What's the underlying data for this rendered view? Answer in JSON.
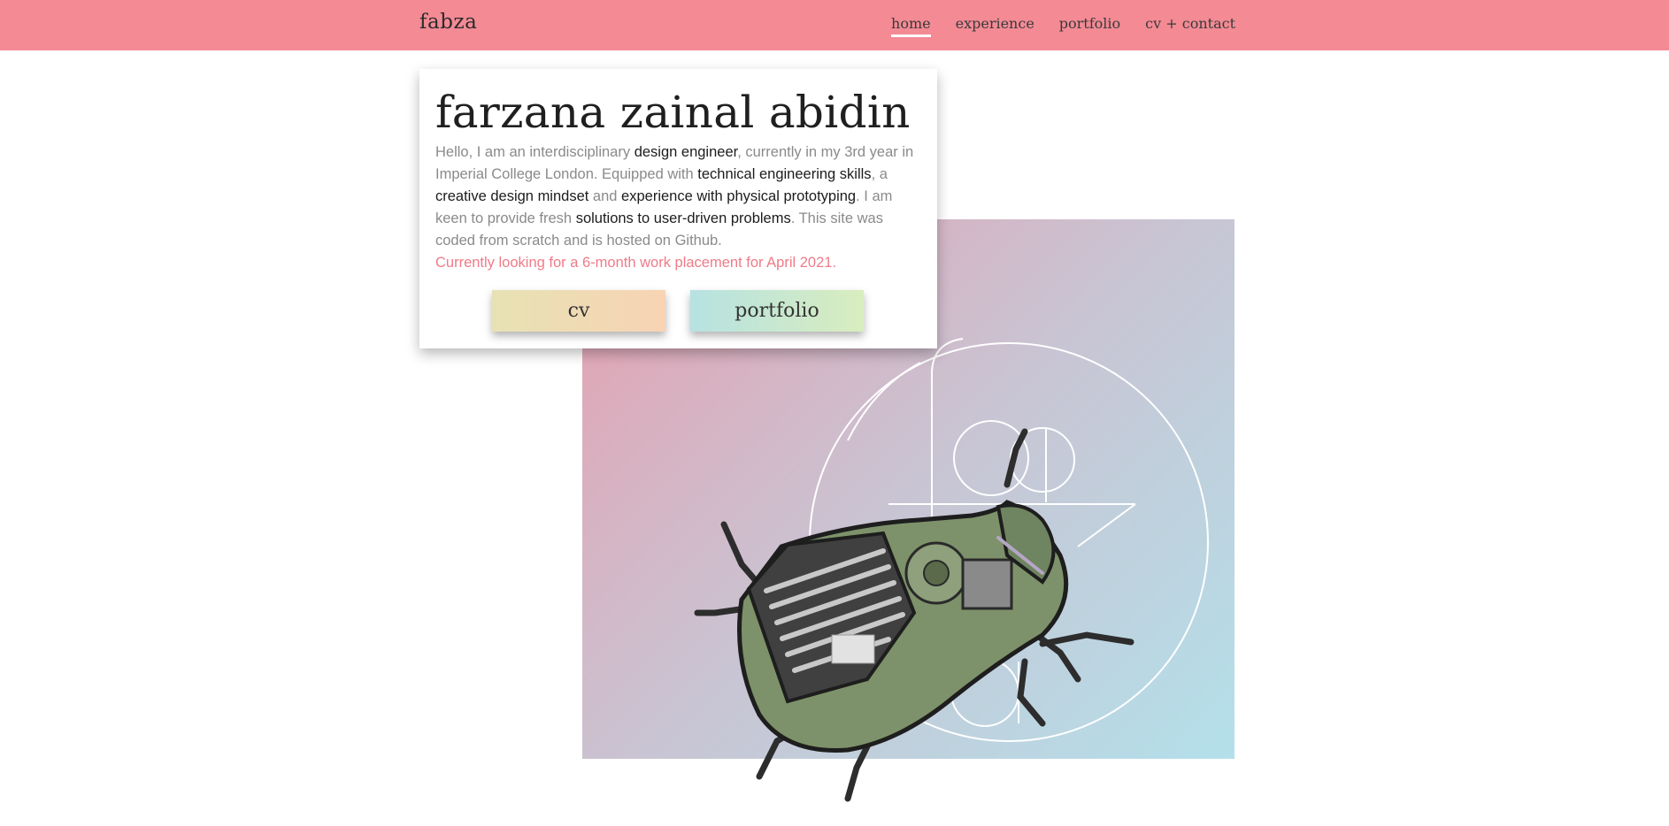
{
  "nav": {
    "brand": "fabza",
    "links": [
      {
        "label": "home",
        "active": true
      },
      {
        "label": "experience",
        "active": false
      },
      {
        "label": "portfolio",
        "active": false
      },
      {
        "label": "cv + contact",
        "active": false
      }
    ]
  },
  "intro": {
    "title": "farzana zainal abidin",
    "segments": [
      "Hello, I am an interdisciplinary ",
      "design engineer",
      ", currently in my 3rd year in Imperial College London. Equipped with ",
      "technical engineering skills",
      ", a ",
      "creative design mindset",
      " and ",
      "experience with physical prototyping",
      ". I am keen to provide fresh ",
      "solutions to user-driven problems",
      ". This site was coded from scratch and is hosted on Github."
    ],
    "notice": "Currently looking for a 6-month work placement for April 2021.",
    "buttons": {
      "cv": "cv",
      "portfolio": "portfolio"
    }
  },
  "colors": {
    "navbar": "#f38a94",
    "accent_text": "#ef7b88",
    "gradient_start": "#e5a0b0",
    "gradient_end": "#b3e0ea"
  },
  "hero": {
    "logo_icon": "fabza-monogram-icon",
    "image_icon": "beetle-robot-render-icon"
  }
}
